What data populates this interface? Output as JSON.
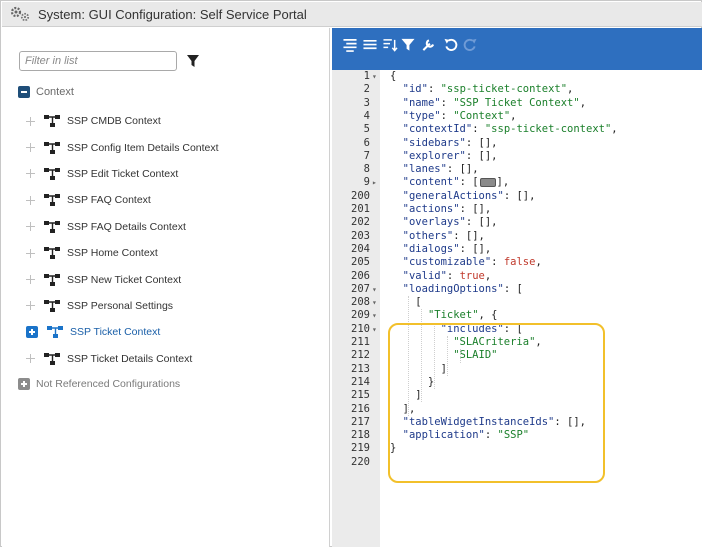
{
  "window": {
    "title": "System: GUI Configuration: Self Service Portal"
  },
  "filter": {
    "placeholder": "Filter in list"
  },
  "tree": {
    "root_label": "Context",
    "items": [
      {
        "label": "SSP CMDB Context"
      },
      {
        "label": "SSP Config Item Details Context"
      },
      {
        "label": "SSP Edit Ticket Context"
      },
      {
        "label": "SSP FAQ Context"
      },
      {
        "label": "SSP FAQ Details Context"
      },
      {
        "label": "SSP Home Context"
      },
      {
        "label": "SSP New Ticket Context"
      },
      {
        "label": "SSP Personal Settings"
      },
      {
        "label": "SSP Ticket Context"
      },
      {
        "label": "SSP Ticket Details Context"
      }
    ],
    "footer_label": "Not Referenced Configurations"
  },
  "toolbar": {
    "buttons": [
      {
        "icon": "format-icon"
      },
      {
        "icon": "compact-icon"
      },
      {
        "icon": "sort-icon"
      },
      {
        "icon": "filter-icon"
      },
      {
        "icon": "repair-icon"
      },
      {
        "icon": "undo-icon"
      },
      {
        "icon": "redo-icon"
      }
    ]
  },
  "code": {
    "lines": [
      {
        "n": "1",
        "fold": "▾",
        "tokens": [
          {
            "t": "{",
            "c": "punc"
          }
        ]
      },
      {
        "n": "2",
        "fold": "",
        "tokens": [
          {
            "t": "  ",
            "c": "punc"
          },
          {
            "t": "\"id\"",
            "c": "key"
          },
          {
            "t": ": ",
            "c": "punc"
          },
          {
            "t": "\"ssp-ticket-context\"",
            "c": "str"
          },
          {
            "t": ",",
            "c": "punc"
          }
        ]
      },
      {
        "n": "3",
        "fold": "",
        "tokens": [
          {
            "t": "  ",
            "c": "punc"
          },
          {
            "t": "\"name\"",
            "c": "key"
          },
          {
            "t": ": ",
            "c": "punc"
          },
          {
            "t": "\"SSP Ticket Context\"",
            "c": "str"
          },
          {
            "t": ",",
            "c": "punc"
          }
        ]
      },
      {
        "n": "4",
        "fold": "",
        "tokens": [
          {
            "t": "  ",
            "c": "punc"
          },
          {
            "t": "\"type\"",
            "c": "key"
          },
          {
            "t": ": ",
            "c": "punc"
          },
          {
            "t": "\"Context\"",
            "c": "str"
          },
          {
            "t": ",",
            "c": "punc"
          }
        ]
      },
      {
        "n": "5",
        "fold": "",
        "tokens": [
          {
            "t": "  ",
            "c": "punc"
          },
          {
            "t": "\"contextId\"",
            "c": "key"
          },
          {
            "t": ": ",
            "c": "punc"
          },
          {
            "t": "\"ssp-ticket-context\"",
            "c": "str"
          },
          {
            "t": ",",
            "c": "punc"
          }
        ]
      },
      {
        "n": "6",
        "fold": "",
        "tokens": [
          {
            "t": "  ",
            "c": "punc"
          },
          {
            "t": "\"sidebars\"",
            "c": "key"
          },
          {
            "t": ": [],",
            "c": "punc"
          }
        ]
      },
      {
        "n": "7",
        "fold": "",
        "tokens": [
          {
            "t": "  ",
            "c": "punc"
          },
          {
            "t": "\"explorer\"",
            "c": "key"
          },
          {
            "t": ": [],",
            "c": "punc"
          }
        ]
      },
      {
        "n": "8",
        "fold": "",
        "tokens": [
          {
            "t": "  ",
            "c": "punc"
          },
          {
            "t": "\"lanes\"",
            "c": "key"
          },
          {
            "t": ": [],",
            "c": "punc"
          }
        ]
      },
      {
        "n": "9",
        "fold": "▸",
        "tokens": [
          {
            "t": "  ",
            "c": "punc"
          },
          {
            "t": "\"content\"",
            "c": "key"
          },
          {
            "t": ": [",
            "c": "punc"
          },
          {
            "t": "",
            "c": "marker"
          },
          {
            "t": "],",
            "c": "punc"
          }
        ]
      },
      {
        "n": "200",
        "fold": "",
        "tokens": [
          {
            "t": "  ",
            "c": "punc"
          },
          {
            "t": "\"generalActions\"",
            "c": "key"
          },
          {
            "t": ": [],",
            "c": "punc"
          }
        ]
      },
      {
        "n": "201",
        "fold": "",
        "tokens": [
          {
            "t": "  ",
            "c": "punc"
          },
          {
            "t": "\"actions\"",
            "c": "key"
          },
          {
            "t": ": [],",
            "c": "punc"
          }
        ]
      },
      {
        "n": "202",
        "fold": "",
        "tokens": [
          {
            "t": "  ",
            "c": "punc"
          },
          {
            "t": "\"overlays\"",
            "c": "key"
          },
          {
            "t": ": [],",
            "c": "punc"
          }
        ]
      },
      {
        "n": "203",
        "fold": "",
        "tokens": [
          {
            "t": "  ",
            "c": "punc"
          },
          {
            "t": "\"others\"",
            "c": "key"
          },
          {
            "t": ": [],",
            "c": "punc"
          }
        ]
      },
      {
        "n": "204",
        "fold": "",
        "tokens": [
          {
            "t": "  ",
            "c": "punc"
          },
          {
            "t": "\"dialogs\"",
            "c": "key"
          },
          {
            "t": ": [],",
            "c": "punc"
          }
        ]
      },
      {
        "n": "205",
        "fold": "",
        "tokens": [
          {
            "t": "  ",
            "c": "punc"
          },
          {
            "t": "\"customizable\"",
            "c": "key"
          },
          {
            "t": ": ",
            "c": "punc"
          },
          {
            "t": "false",
            "c": "bool"
          },
          {
            "t": ",",
            "c": "punc"
          }
        ]
      },
      {
        "n": "206",
        "fold": "",
        "tokens": [
          {
            "t": "  ",
            "c": "punc"
          },
          {
            "t": "\"valid\"",
            "c": "key"
          },
          {
            "t": ": ",
            "c": "punc"
          },
          {
            "t": "true",
            "c": "bool"
          },
          {
            "t": ",",
            "c": "punc"
          }
        ]
      },
      {
        "n": "207",
        "fold": "▾",
        "tokens": [
          {
            "t": "  ",
            "c": "punc"
          },
          {
            "t": "\"loadingOptions\"",
            "c": "key"
          },
          {
            "t": ": [",
            "c": "punc"
          }
        ]
      },
      {
        "n": "208",
        "fold": "▾",
        "tokens": [
          {
            "t": "    [",
            "c": "punc"
          }
        ]
      },
      {
        "n": "209",
        "fold": "▾",
        "tokens": [
          {
            "t": "      ",
            "c": "punc"
          },
          {
            "t": "\"Ticket\"",
            "c": "str"
          },
          {
            "t": ", {",
            "c": "punc"
          }
        ]
      },
      {
        "n": "210",
        "fold": "▾",
        "tokens": [
          {
            "t": "        ",
            "c": "punc"
          },
          {
            "t": "\"includes\"",
            "c": "key"
          },
          {
            "t": ": [",
            "c": "punc"
          }
        ]
      },
      {
        "n": "211",
        "fold": "",
        "tokens": [
          {
            "t": "          ",
            "c": "punc"
          },
          {
            "t": "\"SLACriteria\"",
            "c": "str"
          },
          {
            "t": ",",
            "c": "punc"
          }
        ]
      },
      {
        "n": "212",
        "fold": "",
        "tokens": [
          {
            "t": "          ",
            "c": "punc"
          },
          {
            "t": "\"SLAID\"",
            "c": "str"
          }
        ]
      },
      {
        "n": "213",
        "fold": "",
        "tokens": [
          {
            "t": "        ]",
            "c": "punc"
          }
        ]
      },
      {
        "n": "214",
        "fold": "",
        "tokens": [
          {
            "t": "      }",
            "c": "punc"
          }
        ]
      },
      {
        "n": "215",
        "fold": "",
        "tokens": [
          {
            "t": "    ]",
            "c": "punc"
          }
        ]
      },
      {
        "n": "216",
        "fold": "",
        "tokens": [
          {
            "t": "  ],",
            "c": "punc"
          }
        ]
      },
      {
        "n": "217",
        "fold": "",
        "tokens": [
          {
            "t": "  ",
            "c": "punc"
          },
          {
            "t": "\"tableWidgetInstanceIds\"",
            "c": "key"
          },
          {
            "t": ": [],",
            "c": "punc"
          }
        ]
      },
      {
        "n": "218",
        "fold": "",
        "tokens": [
          {
            "t": "  ",
            "c": "punc"
          },
          {
            "t": "\"application\"",
            "c": "key"
          },
          {
            "t": ": ",
            "c": "punc"
          },
          {
            "t": "\"SSP\"",
            "c": "str"
          }
        ]
      },
      {
        "n": "219",
        "fold": "",
        "tokens": [
          {
            "t": "}",
            "c": "punc"
          }
        ]
      },
      {
        "n": "220",
        "fold": "",
        "tokens": []
      }
    ]
  },
  "colors": {
    "toolbar_bg": "#2e6fbf",
    "highlight": "#f2c02b",
    "active_item": "#1a5fa8"
  }
}
